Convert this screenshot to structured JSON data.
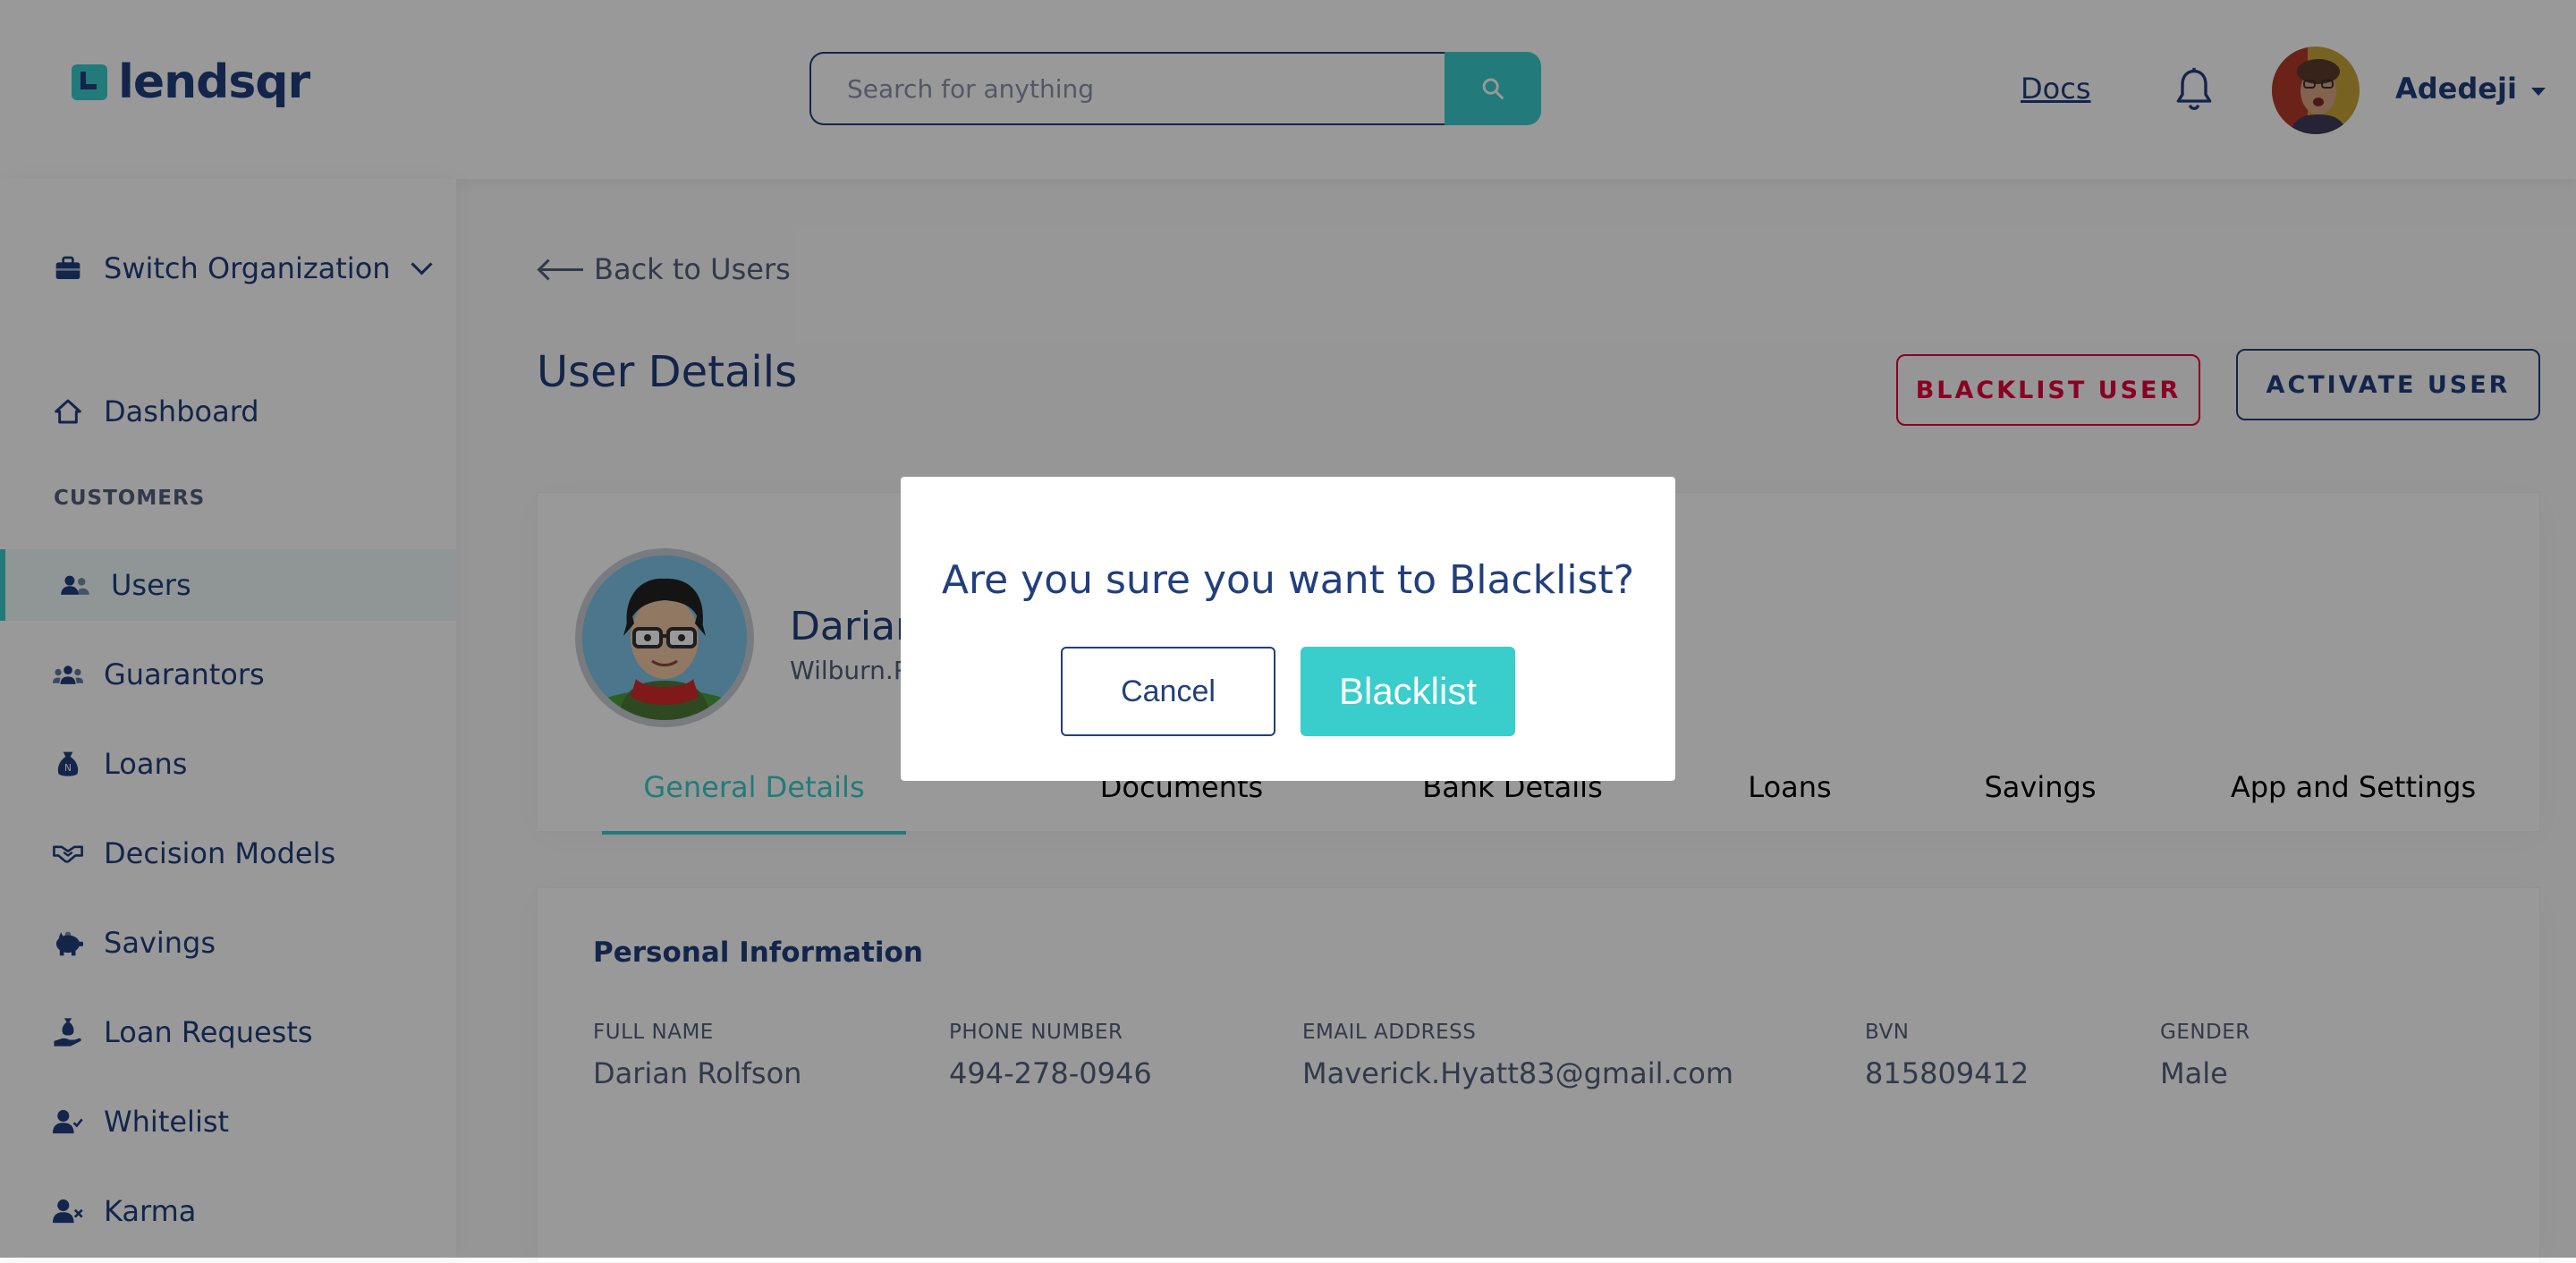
{
  "brand": {
    "name": "lendsqr",
    "accent": "#39CDCC",
    "primary": "#213F7D",
    "danger": "#E4033B"
  },
  "header": {
    "search_placeholder": "Search for anything",
    "docs_label": "Docs",
    "user_name": "Adedeji"
  },
  "sidebar": {
    "switch_org": "Switch Organization",
    "dashboard": "Dashboard",
    "section_customers": "CUSTOMERS",
    "items": [
      {
        "label": "Users",
        "icon": "users-icon",
        "active": true
      },
      {
        "label": "Guarantors",
        "icon": "guarantors-icon"
      },
      {
        "label": "Loans",
        "icon": "loan-sack-icon"
      },
      {
        "label": "Decision Models",
        "icon": "handshake-icon"
      },
      {
        "label": "Savings",
        "icon": "piggy-bank-icon"
      },
      {
        "label": "Loan Requests",
        "icon": "loan-request-icon"
      },
      {
        "label": "Whitelist",
        "icon": "user-check-icon"
      },
      {
        "label": "Karma",
        "icon": "user-x-icon"
      }
    ]
  },
  "main": {
    "back_label": "Back to Users",
    "page_title": "User Details",
    "blacklist_btn": "BLACKLIST USER",
    "activate_btn": "ACTIVATE USER",
    "profile": {
      "name_visible": "Darian",
      "handle_visible": "Wilburn.R"
    },
    "tabs": [
      "General Details",
      "Documents",
      "Bank Details",
      "Loans",
      "Savings",
      "App and Settings"
    ],
    "personal_info": {
      "title": "Personal Information",
      "fields": [
        {
          "label": "FULL NAME",
          "value": "Darian Rolfson"
        },
        {
          "label": "PHONE NUMBER",
          "value": "494-278-0946"
        },
        {
          "label": "EMAIL ADDRESS",
          "value": "Maverick.Hyatt83@gmail.com"
        },
        {
          "label": "BVN",
          "value": "815809412"
        },
        {
          "label": "GENDER",
          "value": "Male"
        }
      ]
    }
  },
  "modal": {
    "title": "Are you sure you want to Blacklist?",
    "cancel": "Cancel",
    "confirm": "Blacklist"
  }
}
